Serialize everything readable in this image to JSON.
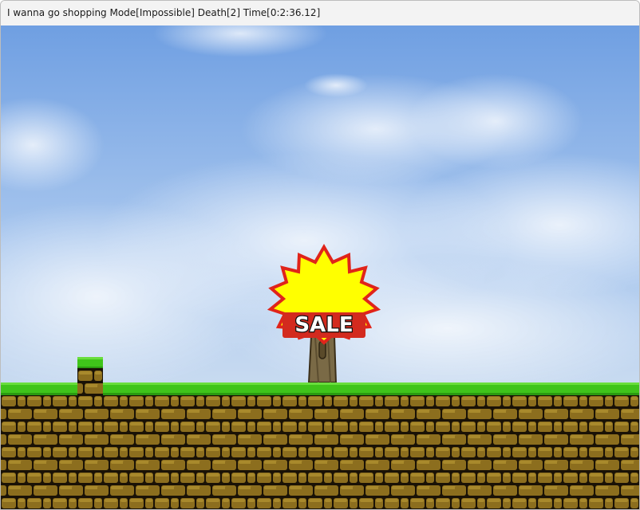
{
  "window": {
    "title": "I wanna go shopping Mode[Impossible] Death[2] Time[0:2:36.12]"
  },
  "scene": {
    "sign_text": "SALE",
    "colors": {
      "sky_top": "#7aa9e6",
      "sky_bottom": "#d9e6f2",
      "grass": "#3fc41a",
      "grass_dark": "#2a9a10",
      "brick": "#8c6e1e",
      "brick_light": "#a8892c",
      "mortar": "#1a1206",
      "sign_burst": "#ffff00",
      "sign_burst_outline": "#e0241a",
      "sign_plate": "#d32a1e",
      "trunk": "#7a6a46"
    }
  }
}
